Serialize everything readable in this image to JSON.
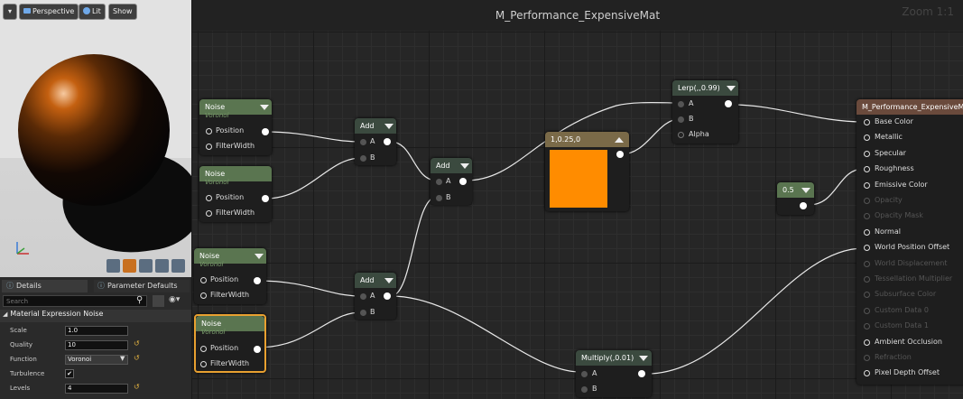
{
  "viewport": {
    "menu_label": "▾",
    "perspective_label": "Perspective",
    "lit_label": "Lit",
    "show_label": "Show"
  },
  "details": {
    "tab_details": "Details",
    "tab_params": "Parameter Defaults",
    "search_placeholder": "Search",
    "section_title": "Material Expression Noise",
    "rows": [
      {
        "label": "Scale",
        "value": "1.0"
      },
      {
        "label": "Quality",
        "value": "10"
      },
      {
        "label": "Function",
        "value": "Voronoi"
      },
      {
        "label": "Turbulence",
        "value": "✔"
      },
      {
        "label": "Levels",
        "value": "4"
      }
    ]
  },
  "graph": {
    "title": "M_Performance_ExpensiveMat",
    "zoom": "Zoom 1:1",
    "noise_nodes": [
      {
        "title": "Noise",
        "subtitle": "Voronoi",
        "pin1": "Position",
        "pin2": "FilterWidth"
      },
      {
        "title": "Noise",
        "subtitle": "Voronoi",
        "pin1": "Position",
        "pin2": "FilterWidth"
      },
      {
        "title": "Noise",
        "subtitle": "Voronoi",
        "pin1": "Position",
        "pin2": "FilterWidth"
      },
      {
        "title": "Noise",
        "subtitle": "Voronoi",
        "pin1": "Position",
        "pin2": "FilterWidth"
      }
    ],
    "add_nodes": [
      {
        "title": "Add",
        "a": "A",
        "b": "B"
      },
      {
        "title": "Add",
        "a": "A",
        "b": "B"
      },
      {
        "title": "Add",
        "a": "A",
        "b": "B"
      }
    ],
    "constant_node": {
      "title": "1,0.25,0",
      "color": "#ff8c00"
    },
    "lerp_node": {
      "title": "Lerp(,,0.99)",
      "a": "A",
      "b": "B",
      "alpha": "Alpha"
    },
    "scalar_node": {
      "title": "0.5"
    },
    "multiply_node": {
      "title": "Multiply(,0.01)",
      "a": "A",
      "b": "B"
    },
    "result_node": {
      "title": "M_Performance_ExpensiveMat",
      "pins": [
        {
          "label": "Base Color",
          "active": true
        },
        {
          "label": "Metallic",
          "active": true
        },
        {
          "label": "Specular",
          "active": true
        },
        {
          "label": "Roughness",
          "active": true
        },
        {
          "label": "Emissive Color",
          "active": true
        },
        {
          "label": "Opacity",
          "active": false
        },
        {
          "label": "Opacity Mask",
          "active": false
        },
        {
          "label": "Normal",
          "active": true
        },
        {
          "label": "World Position Offset",
          "active": true
        },
        {
          "label": "World Displacement",
          "active": false
        },
        {
          "label": "Tessellation Multiplier",
          "active": false
        },
        {
          "label": "Subsurface Color",
          "active": false
        },
        {
          "label": "Custom Data 0",
          "active": false
        },
        {
          "label": "Custom Data 1",
          "active": false
        },
        {
          "label": "Ambient Occlusion",
          "active": true
        },
        {
          "label": "Refraction",
          "active": false
        },
        {
          "label": "Pixel Depth Offset",
          "active": true
        }
      ]
    },
    "colors": {
      "accent_orange": "#ff8c00",
      "noise_header": "#5a7550",
      "selection": "#e8a030"
    }
  }
}
